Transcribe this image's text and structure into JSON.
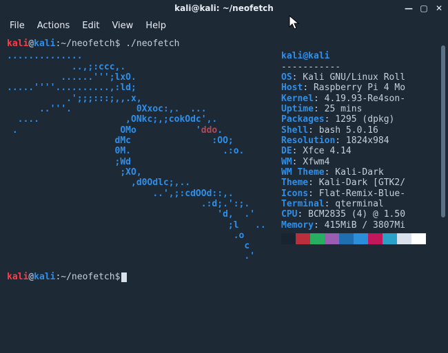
{
  "window_title": "kali@kali: ~/neofetch",
  "menubar": {
    "file": "File",
    "actions": "Actions",
    "edit": "Edit",
    "view": "View",
    "help": "Help"
  },
  "prompt": {
    "user": "kali",
    "at": "@",
    "host": "kali",
    "colon": ":",
    "path": "~/neofetch",
    "dollar": "$",
    "command": "./neofetch"
  },
  "ascii": {
    "l01": "..............",
    "l02": "            ..,;:ccc,.",
    "l03": "          ......''';lxO.",
    "l04": ".....''''..........,:ld;",
    "l05": "           .';;;:::;,,.x,",
    "l06": "      ..'''.            0Xxoc:,.  ...",
    "l07": "  ....                ,ONkc;,;cokOdc',.",
    "l08a": " .                   OMo           '",
    "l08b": "ddo",
    "l08c": ".",
    "l09": "                    dMc               :OO;",
    "l10": "                    0M.                 .:o.",
    "l11": "                    ;Wd",
    "l12": "                     ;XO,",
    "l13": "                       ,d0Odlc;,..",
    "l14": "                           ..',;:cdOOd::,.",
    "l15": "                                    .:d;.':;.",
    "l16": "                                       'd,  .'",
    "l17": "                                         ;l   ..",
    "l18": "                                          .o",
    "l19": "                                            c",
    "l20": "                                            .'"
  },
  "info": {
    "userhost_user": "kali",
    "userhost_at": "@",
    "userhost_host": "kali",
    "dash": "-----------",
    "os_k": "OS",
    "os_v": ": Kali GNU/Linux Roll",
    "host_k": "Host",
    "host_v": ": Raspberry Pi 4 Mo",
    "kernel_k": "Kernel",
    "kernel_v": ": 4.19.93-Re4son-",
    "uptime_k": "Uptime",
    "uptime_v": ": 25 mins",
    "packages_k": "Packages",
    "packages_v": ": 1295 (dpkg)",
    "shell_k": "Shell",
    "shell_v": ": bash 5.0.16",
    "resolution_k": "Resolution",
    "resolution_v": ": 1824x984",
    "de_k": "DE",
    "de_v": ": Xfce 4.14",
    "wm_k": "WM",
    "wm_v": ": Xfwm4",
    "wmtheme_k": "WM Theme",
    "wmtheme_v": ": Kali-Dark",
    "theme_k": "Theme",
    "theme_v": ": Kali-Dark [GTK2/",
    "icons_k": "Icons",
    "icons_v": ": Flat-Remix-Blue-",
    "terminal_k": "Terminal",
    "terminal_v": ": qterminal",
    "cpu_k": "CPU",
    "cpu_v": ": BCM2835 (4) @ 1.50",
    "memory_k": "Memory",
    "memory_v": ": 415MiB / 3807Mi"
  },
  "swatches": [
    "#1a2430",
    "#bb2e3c",
    "#27ae60",
    "#9b5db2",
    "#1f6fb0",
    "#2a8fd8",
    "#c2185b",
    "#2aa1c9",
    "#d9e2eb",
    "#ffffff"
  ]
}
